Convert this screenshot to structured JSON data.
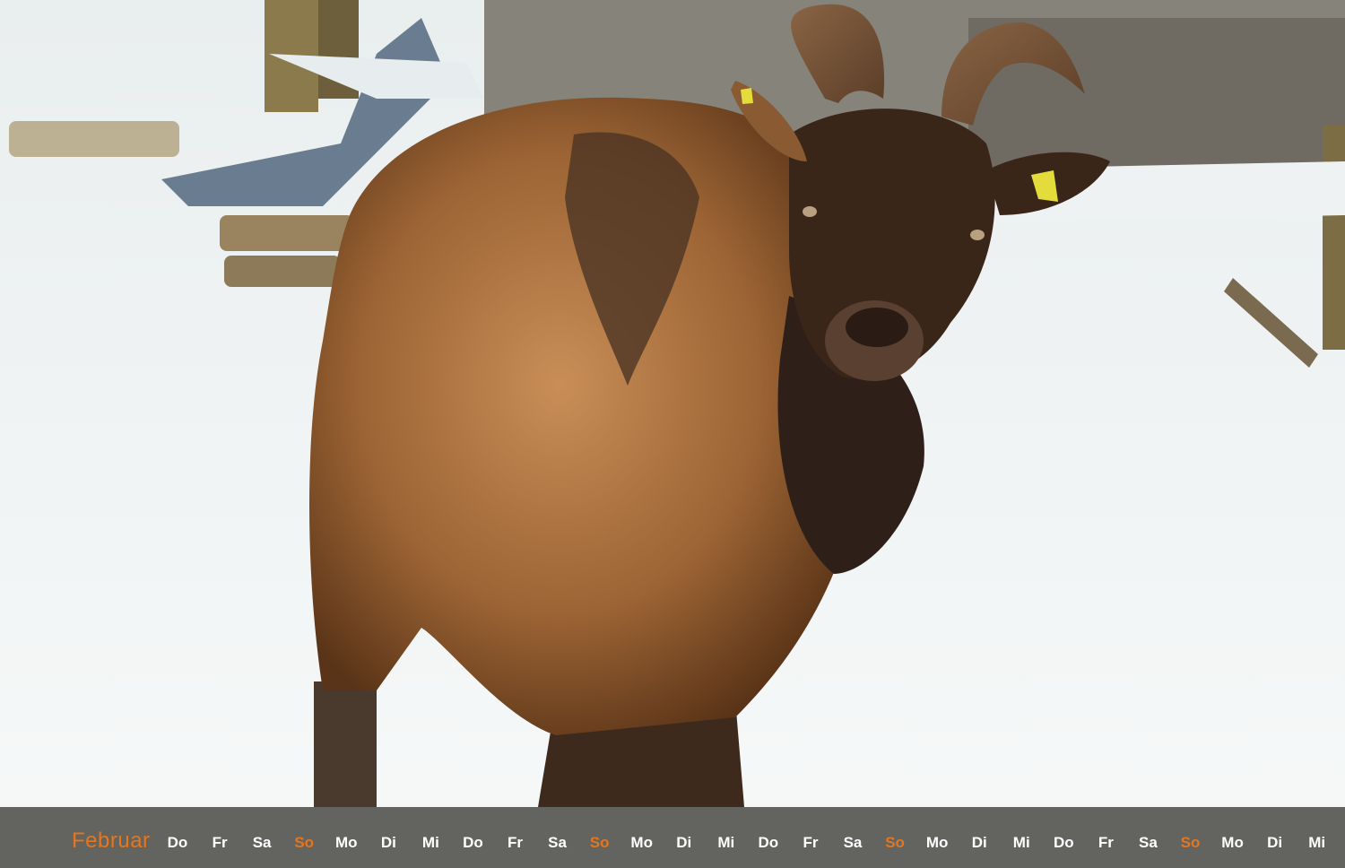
{
  "calendar": {
    "month": "Februar",
    "days": [
      "Do",
      "Fr",
      "Sa",
      "So",
      "Mo",
      "Di",
      "Mi",
      "Do",
      "Fr",
      "Sa",
      "So",
      "Mo",
      "Di",
      "Mi",
      "Do",
      "Fr",
      "Sa",
      "So",
      "Mo",
      "Di",
      "Mi",
      "Do",
      "Fr",
      "Sa",
      "So",
      "Mo",
      "Di",
      "Mi"
    ],
    "sunday_label": "So"
  },
  "colors": {
    "accent": "#e5761d",
    "weekday_text": "#ffffff",
    "bar_background": "#3a3a34"
  }
}
